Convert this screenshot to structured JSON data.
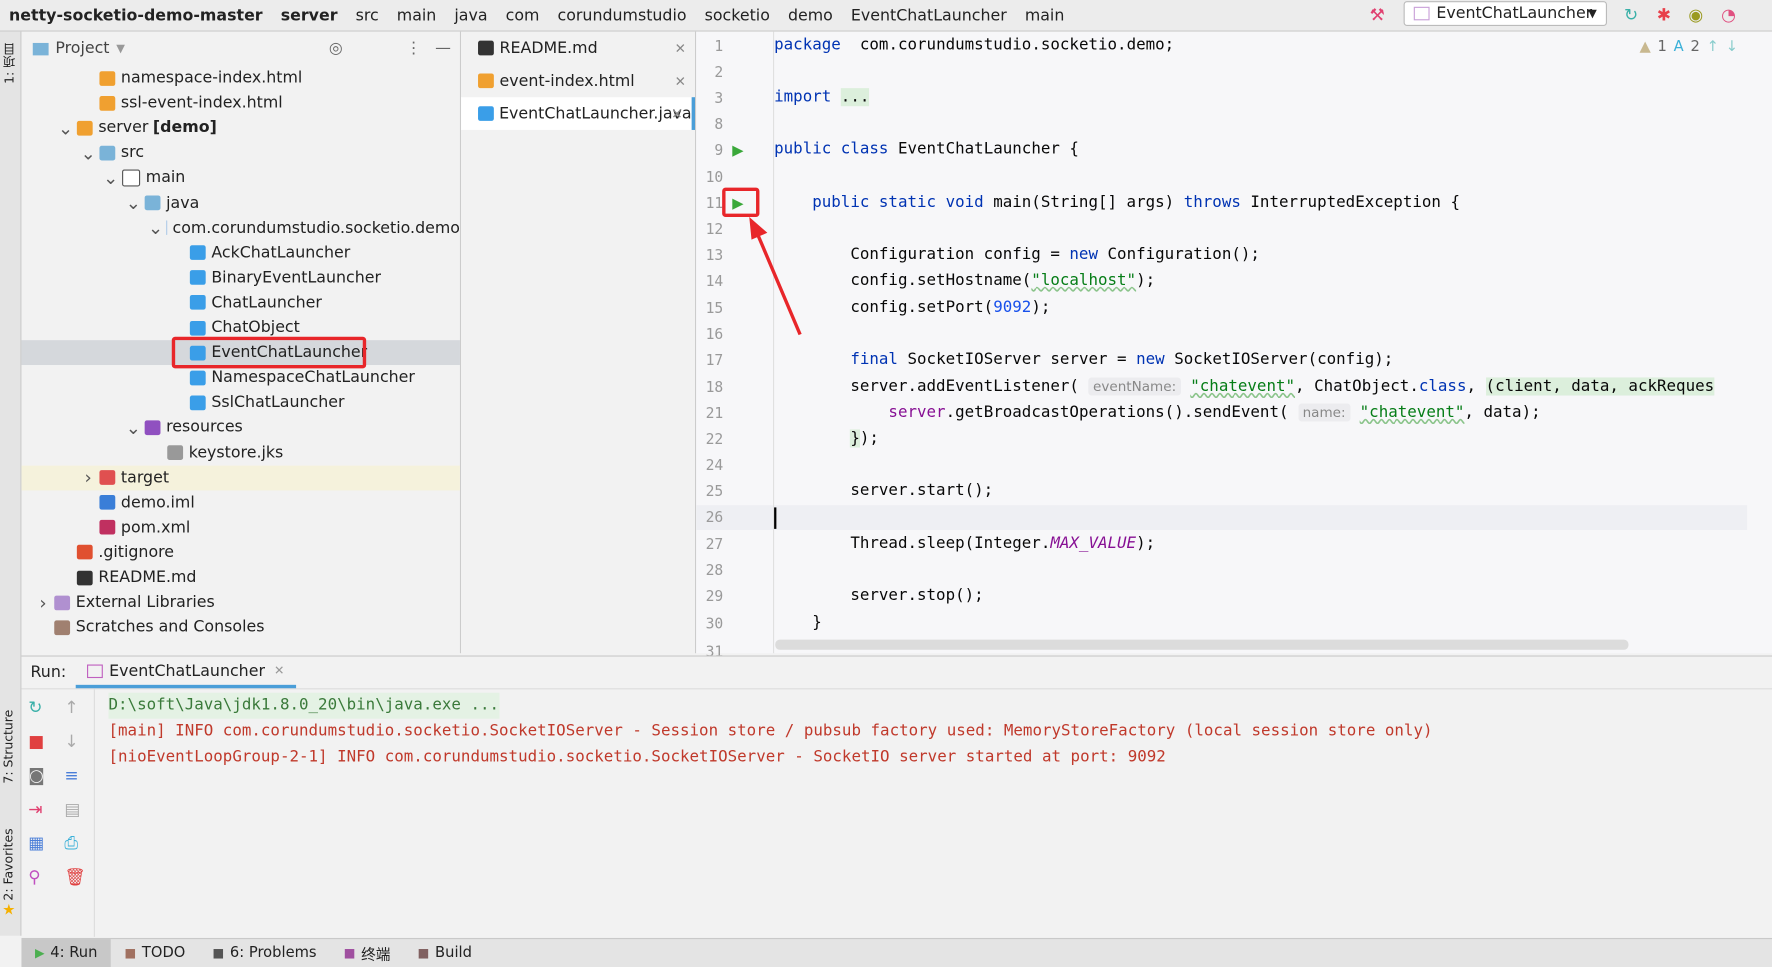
{
  "breadcrumbs": [
    "netty-socketio-demo-master",
    "server",
    "src",
    "main",
    "java",
    "com",
    "corundumstudio",
    "socketio",
    "demo",
    "EventChatLauncher",
    "main"
  ],
  "toolbar": {
    "run_config": "EventChatLauncher",
    "icons": [
      "build-hammer-icon",
      "rerun-icon",
      "debug-bug-icon",
      "run-coverage-icon",
      "profiler-icon"
    ]
  },
  "left_strip": {
    "project": "1: 项目",
    "structure": "7: Structure",
    "favorites": "2: Favorites"
  },
  "project": {
    "title": "Project",
    "tree": [
      {
        "label": "namespace-index.html",
        "level": 3,
        "icon": "html"
      },
      {
        "label": "ssl-event-index.html",
        "level": 3,
        "icon": "html"
      },
      {
        "label": "server",
        "suffix": "[demo]",
        "level": 2,
        "icon": "module",
        "expanded": true
      },
      {
        "label": "src",
        "level": 3,
        "icon": "folder-src",
        "expanded": true
      },
      {
        "label": "main",
        "level": 4,
        "icon": "folder",
        "expanded": true
      },
      {
        "label": "java",
        "level": 5,
        "icon": "folder-src",
        "expanded": true
      },
      {
        "label": "com.corundumstudio.socketio.demo",
        "level": 6,
        "icon": "package",
        "expanded": true
      },
      {
        "label": "AckChatLauncher",
        "level": 7,
        "icon": "class"
      },
      {
        "label": "BinaryEventLauncher",
        "level": 7,
        "icon": "class"
      },
      {
        "label": "ChatLauncher",
        "level": 7,
        "icon": "class"
      },
      {
        "label": "ChatObject",
        "level": 7,
        "icon": "class"
      },
      {
        "label": "EventChatLauncher",
        "level": 7,
        "icon": "class",
        "selected": true
      },
      {
        "label": "NamespaceChatLauncher",
        "level": 7,
        "icon": "class"
      },
      {
        "label": "SslChatLauncher",
        "level": 7,
        "icon": "class"
      },
      {
        "label": "resources",
        "level": 5,
        "icon": "folder-res",
        "expanded": true
      },
      {
        "label": "keystore.jks",
        "level": 6,
        "icon": "file"
      },
      {
        "label": "target",
        "level": 3,
        "icon": "folder-target",
        "expanded": false
      },
      {
        "label": "demo.iml",
        "level": 3,
        "icon": "iml"
      },
      {
        "label": "pom.xml",
        "level": 3,
        "icon": "maven"
      },
      {
        "label": ".gitignore",
        "level": 2,
        "icon": "git"
      },
      {
        "label": "README.md",
        "level": 2,
        "icon": "md"
      },
      {
        "label": "External Libraries",
        "level": 1,
        "icon": "lib",
        "expanded": false
      },
      {
        "label": "Scratches and Consoles",
        "level": 1,
        "icon": "scratch"
      }
    ]
  },
  "file_tabs": [
    {
      "label": "README.md",
      "icon": "md"
    },
    {
      "label": "event-index.html",
      "icon": "html"
    },
    {
      "label": "EventChatLauncher.java",
      "icon": "class",
      "active": true
    }
  ],
  "inspections": {
    "warnings": "1",
    "typos": "2"
  },
  "editor": {
    "lines": [
      {
        "n": "1",
        "t": [
          [
            "kw",
            "package"
          ],
          [
            "",
            "  com.corundumstudio.socketio.demo;"
          ]
        ]
      },
      {
        "n": "2",
        "t": []
      },
      {
        "n": "3",
        "t": [
          [
            "kw",
            "import"
          ],
          [
            "",
            " "
          ],
          [
            "lam",
            "..."
          ]
        ]
      },
      {
        "n": "8",
        "t": []
      },
      {
        "n": "9",
        "t": [
          [
            "kw",
            "public class"
          ],
          [
            "",
            " EventChatLauncher {"
          ]
        ]
      },
      {
        "n": "10",
        "t": []
      },
      {
        "n": "11",
        "t": [
          [
            "",
            "    "
          ],
          [
            "kw",
            "public static void"
          ],
          [
            "",
            " main(String[] args) "
          ],
          [
            "kw",
            "throws"
          ],
          [
            "",
            " InterruptedException {"
          ]
        ]
      },
      {
        "n": "12",
        "t": []
      },
      {
        "n": "13",
        "t": [
          [
            "",
            "        Configuration config = "
          ],
          [
            "kw",
            "new"
          ],
          [
            "",
            " Configuration();"
          ]
        ]
      },
      {
        "n": "14",
        "t": [
          [
            "",
            "        config.setHostname("
          ],
          [
            "str",
            "\"localhost\""
          ],
          [
            "",
            ");"
          ]
        ]
      },
      {
        "n": "15",
        "t": [
          [
            "",
            "        config.setPort("
          ],
          [
            "num",
            "9092"
          ],
          [
            "",
            ");"
          ]
        ]
      },
      {
        "n": "16",
        "t": []
      },
      {
        "n": "17",
        "t": [
          [
            "",
            "        "
          ],
          [
            "kw",
            "final"
          ],
          [
            "",
            " SocketIOServer server = "
          ],
          [
            "kw",
            "new"
          ],
          [
            "",
            " SocketIOServer(config);"
          ]
        ]
      },
      {
        "n": "18",
        "t": [
          [
            "",
            "        server.addEventListener( "
          ],
          [
            "hint",
            "eventName:"
          ],
          [
            "",
            " "
          ],
          [
            "str",
            "\"chatevent\""
          ],
          [
            "",
            ", ChatObject."
          ],
          [
            "kw",
            "class"
          ],
          [
            "",
            ", "
          ],
          [
            "lam",
            "(client, data, ackReques"
          ]
        ]
      },
      {
        "n": "21",
        "t": [
          [
            "",
            "            "
          ],
          [
            "fld2",
            "server"
          ],
          [
            "",
            ".getBroadcastOperations().sendEvent( "
          ],
          [
            "hint",
            "name:"
          ],
          [
            "",
            " "
          ],
          [
            "str",
            "\"chatevent\""
          ],
          [
            "",
            ", data);"
          ]
        ]
      },
      {
        "n": "22",
        "t": [
          [
            "",
            "        "
          ],
          [
            "lam",
            "}"
          ],
          [
            "",
            ");"
          ]
        ]
      },
      {
        "n": "24",
        "t": []
      },
      {
        "n": "25",
        "t": [
          [
            "",
            "        server.start();"
          ]
        ]
      },
      {
        "n": "26",
        "t": []
      },
      {
        "n": "27",
        "t": [
          [
            "",
            "        Thread.sleep(Integer."
          ],
          [
            "fld",
            "MAX_VALUE"
          ],
          [
            "",
            ");"
          ]
        ]
      },
      {
        "n": "28",
        "t": []
      },
      {
        "n": "29",
        "t": [
          [
            "",
            "        server.stop();"
          ]
        ]
      },
      {
        "n": "30",
        "t": [
          [
            "",
            "    }"
          ]
        ]
      },
      {
        "n": "31",
        "t": []
      }
    ]
  },
  "run": {
    "label": "Run:",
    "tab": "EventChatLauncher",
    "console": [
      {
        "text": "D:\\soft\\Java\\jdk1.8.0_20\\bin\\java.exe ...",
        "kind": "cmd"
      },
      {
        "text": "[main] INFO com.corundumstudio.socketio.SocketIOServer - Session store / pubsub factory used: MemoryStoreFactory (local session store only)",
        "kind": "err"
      },
      {
        "text": "[nioEventLoopGroup-2-1] INFO com.corundumstudio.socketio.SocketIOServer - SocketIO server started at port: 9092",
        "kind": "err"
      }
    ]
  },
  "bottom_tabs": [
    {
      "label": "4: Run",
      "icon": "run-icon",
      "active": true
    },
    {
      "label": "TODO",
      "icon": "todo-icon"
    },
    {
      "label": "6: Problems",
      "icon": "problems-icon"
    },
    {
      "label": "终端",
      "icon": "terminal-icon"
    },
    {
      "label": "Build",
      "icon": "build-icon"
    }
  ],
  "colors": {
    "highlight": "#e8262a",
    "run_green": "#4caf50",
    "keyword": "#0033b3",
    "string": "#067d17",
    "console_text": "#c0392b"
  }
}
